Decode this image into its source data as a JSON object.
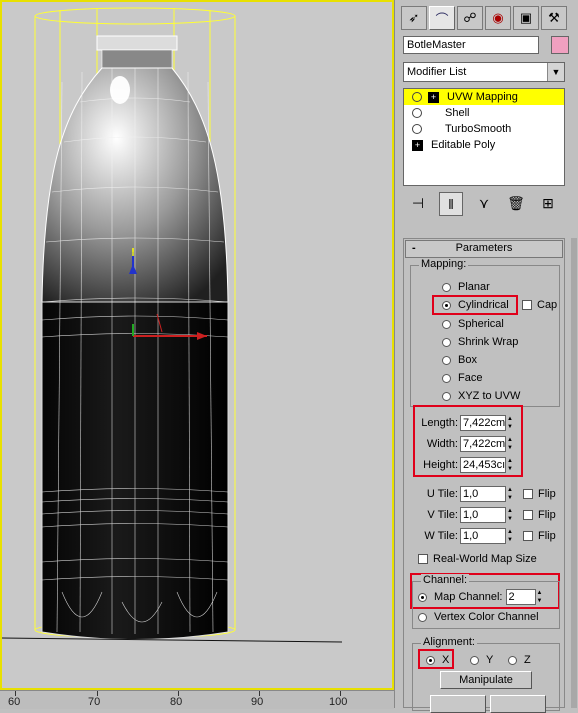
{
  "panel": {
    "tabs": [
      "create-icon",
      "modify-icon",
      "hierarchy-icon",
      "motion-icon",
      "display-icon",
      "utilities-icon"
    ],
    "object_name": "BotleMaster",
    "object_color": "#f0a0c0",
    "modifier_list": "Modifier List",
    "stack": [
      {
        "label": "UVW Mapping",
        "selected": true
      },
      {
        "label": "Shell"
      },
      {
        "label": "TurboSmooth"
      },
      {
        "label": "Editable Poly"
      }
    ]
  },
  "params": {
    "title": "Parameters",
    "collapse": "-",
    "mapping_label": "Mapping:",
    "mapping_options": [
      "Planar",
      "Cylindrical",
      "Spherical",
      "Shrink Wrap",
      "Box",
      "Face",
      "XYZ to UVW"
    ],
    "mapping_selected": "Cylindrical",
    "cap_label": "Cap",
    "length_label": "Length:",
    "length_value": "7,422cm",
    "width_label": "Width:",
    "width_value": "7,422cm",
    "height_label": "Height:",
    "height_value": "24,453cı",
    "utile_label": "U Tile:",
    "utile_value": "1,0",
    "vtile_label": "V Tile:",
    "vtile_value": "1,0",
    "wtile_label": "W Tile:",
    "wtile_value": "1,0",
    "flip_label": "Flip",
    "realworld_label": "Real-World Map Size",
    "channel_label": "Channel:",
    "map_channel_label": "Map Channel:",
    "map_channel_value": "2",
    "vertex_color_label": "Vertex Color Channel",
    "alignment_label": "Alignment:",
    "align_x": "X",
    "align_y": "Y",
    "align_z": "Z",
    "manipulate_label": "Manipulate"
  },
  "ruler": {
    "labels": [
      "60",
      "70",
      "80",
      "90",
      "100"
    ]
  },
  "colors": {
    "highlight_red": "#e0001a",
    "selected_yellow": "#ffff00",
    "viewport_border": "#e8e000"
  }
}
